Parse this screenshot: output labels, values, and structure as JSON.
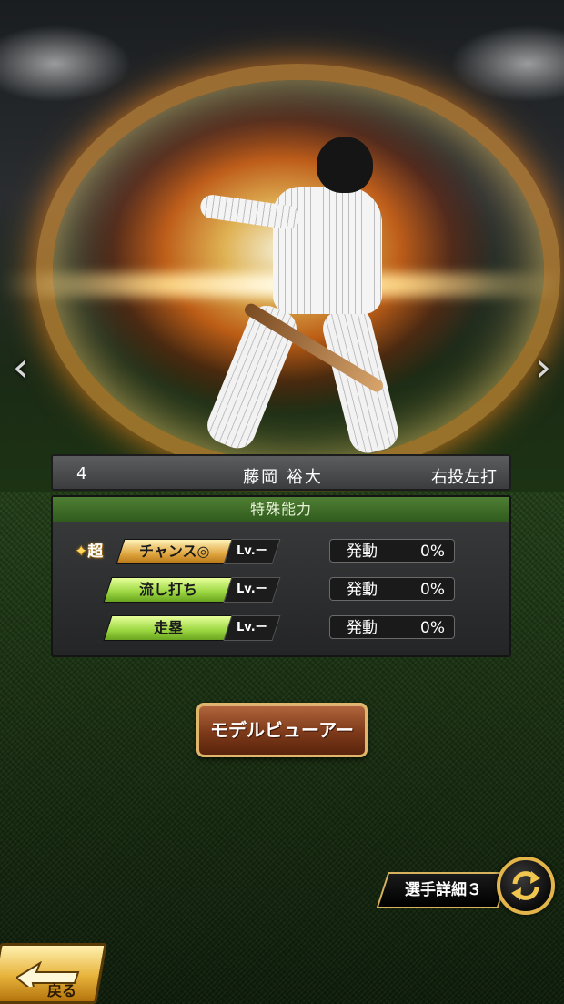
{
  "player": {
    "number": "4",
    "name": "藤岡 裕大",
    "handedness": "右投左打"
  },
  "abilities_panel": {
    "title": "特殊能力",
    "items": [
      {
        "prefix": "超",
        "name": "チャンス◎",
        "level": "Lv.ー",
        "trigger_label": "発動",
        "trigger_value": "0%",
        "tier": "gold"
      },
      {
        "prefix": "",
        "name": "流し打ち",
        "level": "Lv.ー",
        "trigger_label": "発動",
        "trigger_value": "0%",
        "tier": "green"
      },
      {
        "prefix": "",
        "name": "走塁",
        "level": "Lv.ー",
        "trigger_label": "発動",
        "trigger_value": "0%",
        "tier": "green"
      }
    ]
  },
  "buttons": {
    "model_viewer": "モデルビューアー",
    "player_detail": "選手詳細３",
    "back": "戻る"
  },
  "navigation": {
    "prev_arrow": "‹",
    "next_arrow": "›"
  },
  "colors": {
    "panel_header": "#2f5a1d",
    "gold_tag": "#e0a640",
    "green_tag": "#9ad640",
    "button_brown": "#7d3a1a",
    "gold_border": "#d8b25e"
  },
  "icons": [
    "chevron-left-icon",
    "chevron-right-icon",
    "swap-icon",
    "back-arrow-icon"
  ]
}
